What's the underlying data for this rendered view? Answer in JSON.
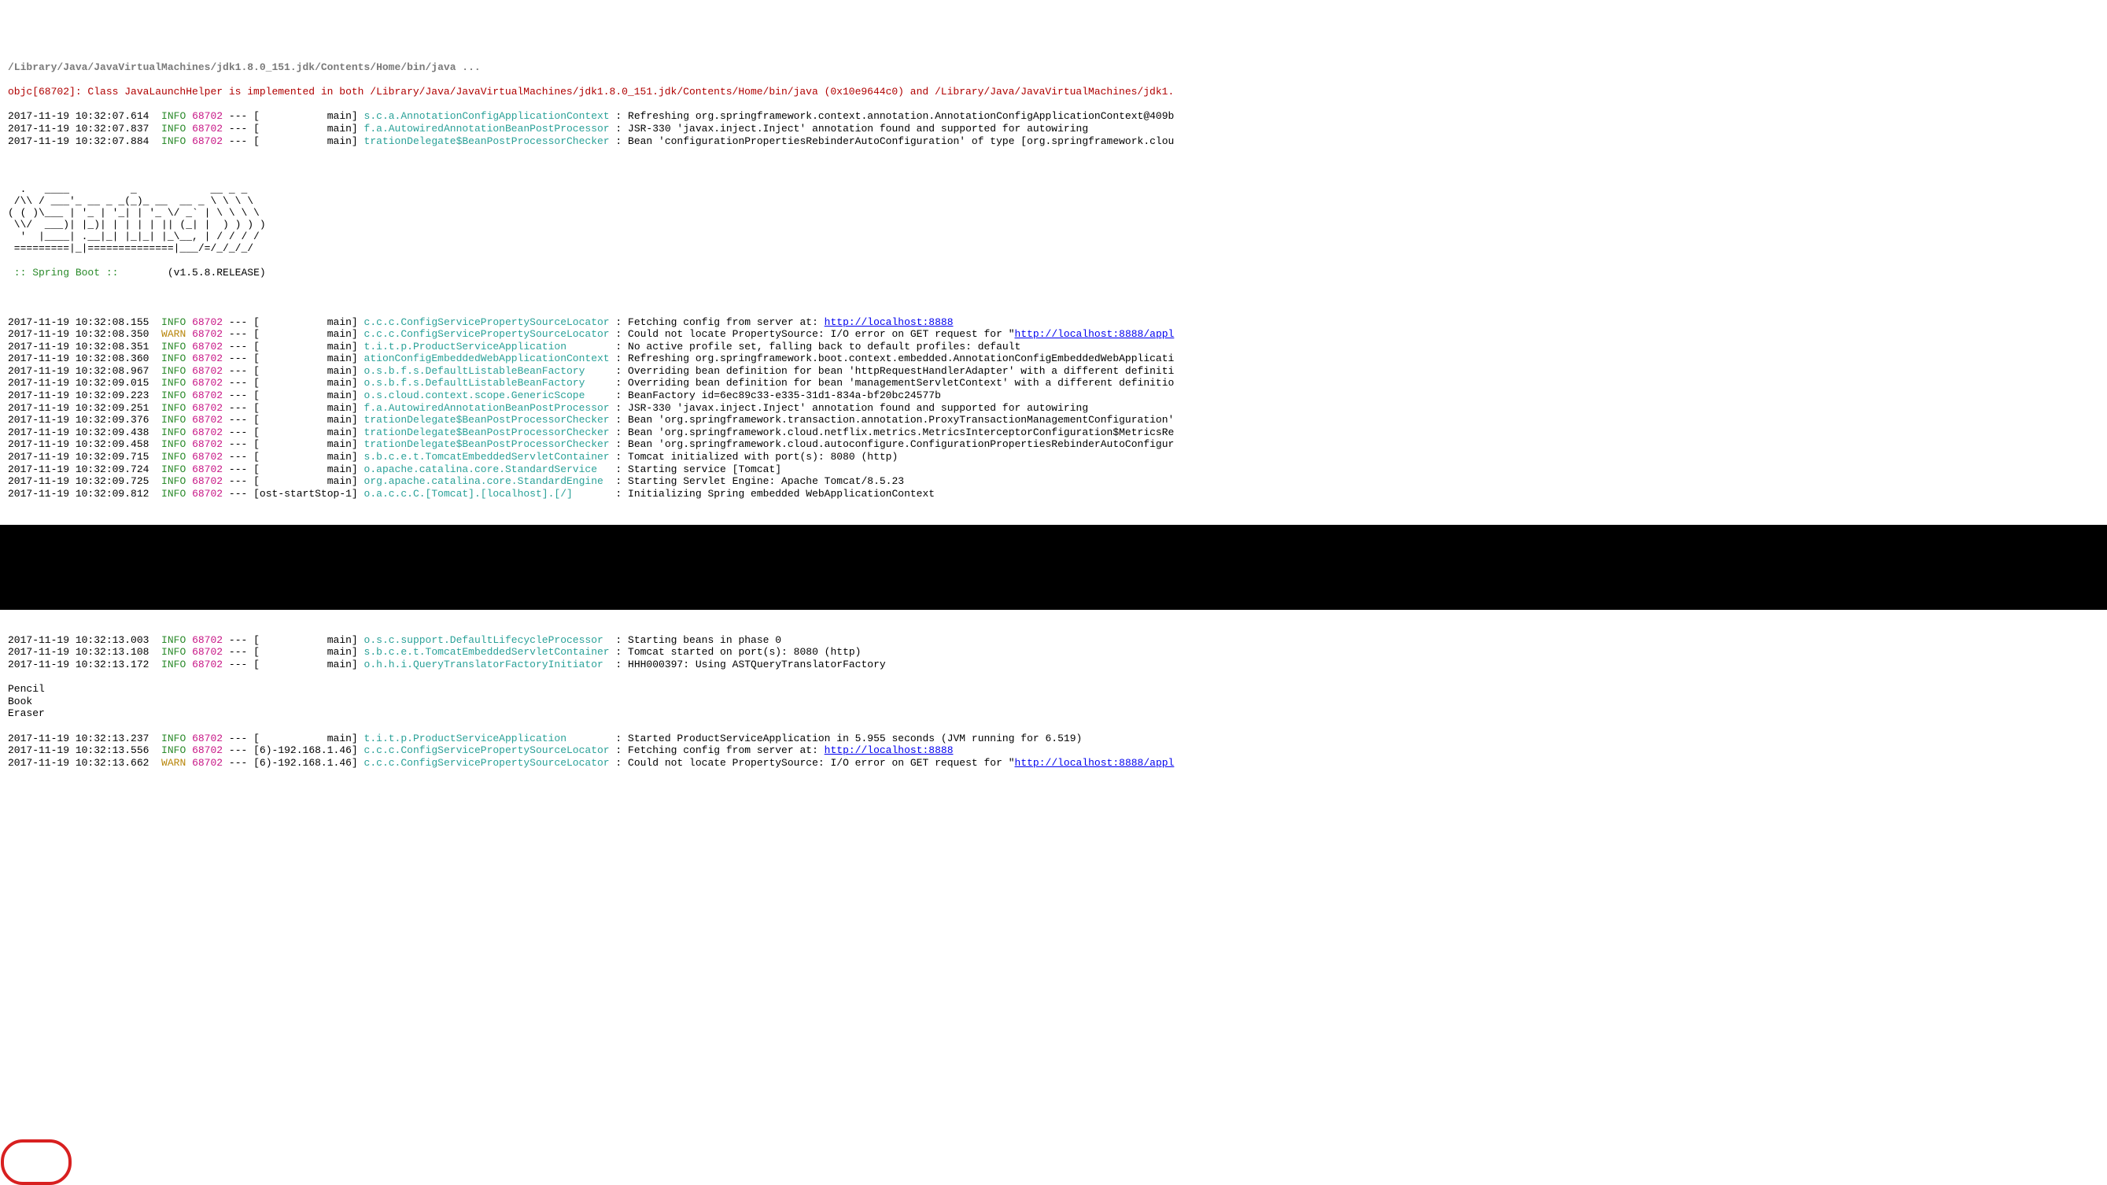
{
  "header": "/Library/Java/JavaVirtualMachines/jdk1.8.0_151.jdk/Contents/Home/bin/java ...",
  "objc": "objc[68702]: Class JavaLaunchHelper is implemented in both /Library/Java/JavaVirtualMachines/jdk1.8.0_151.jdk/Contents/Home/bin/java (0x10e9644c0) and /Library/Java/JavaVirtualMachines/jdk1.",
  "pre_logs": [
    {
      "ts": "2017-11-19 10:32:07.614",
      "lvl": "INFO",
      "pid": "68702",
      "thread": "[           main]",
      "logger": "s.c.a.AnnotationConfigApplicationContext",
      "msg": ": Refreshing org.springframework.context.annotation.AnnotationConfigApplicationContext@409b"
    },
    {
      "ts": "2017-11-19 10:32:07.837",
      "lvl": "INFO",
      "pid": "68702",
      "thread": "[           main]",
      "logger": "f.a.AutowiredAnnotationBeanPostProcessor",
      "msg": ": JSR-330 'javax.inject.Inject' annotation found and supported for autowiring"
    },
    {
      "ts": "2017-11-19 10:32:07.884",
      "lvl": "INFO",
      "pid": "68702",
      "thread": "[           main]",
      "logger": "trationDelegate$BeanPostProcessorChecker",
      "msg": ": Bean 'configurationPropertiesRebinderAutoConfiguration' of type [org.springframework.clou"
    }
  ],
  "ascii": [
    "  .   ____          _            __ _ _",
    " /\\\\ / ___'_ __ _ _(_)_ __  __ _ \\ \\ \\ \\",
    "( ( )\\___ | '_ | '_| | '_ \\/ _` | \\ \\ \\ \\",
    " \\\\/  ___)| |_)| | | | | || (_| |  ) ) ) )",
    "  '  |____| .__|_| |_|_| |_\\__, | / / / /",
    " =========|_|==============|___/=/_/_/_/"
  ],
  "spring_label": " :: Spring Boot ::",
  "spring_version": "        (v1.5.8.RELEASE)",
  "mid_logs": [
    {
      "ts": "2017-11-19 10:32:08.155",
      "lvl": "INFO",
      "pid": "68702",
      "thread": "[           main]",
      "logger": "c.c.c.ConfigServicePropertySourceLocator",
      "msg_pre": ": Fetching config from server at: ",
      "link": "http://localhost:8888",
      "msg_post": ""
    },
    {
      "ts": "2017-11-19 10:32:08.350",
      "lvl": "WARN",
      "pid": "68702",
      "thread": "[           main]",
      "logger": "c.c.c.ConfigServicePropertySourceLocator",
      "msg_pre": ": Could not locate PropertySource: I/O error on GET request for \"",
      "link": "http://localhost:8888/appl",
      "msg_post": ""
    },
    {
      "ts": "2017-11-19 10:32:08.351",
      "lvl": "INFO",
      "pid": "68702",
      "thread": "[           main]",
      "logger": "t.i.t.p.ProductServiceApplication       ",
      "msg": ": No active profile set, falling back to default profiles: default"
    },
    {
      "ts": "2017-11-19 10:32:08.360",
      "lvl": "INFO",
      "pid": "68702",
      "thread": "[           main]",
      "logger": "ationConfigEmbeddedWebApplicationContext",
      "msg": ": Refreshing org.springframework.boot.context.embedded.AnnotationConfigEmbeddedWebApplicati"
    },
    {
      "ts": "2017-11-19 10:32:08.967",
      "lvl": "INFO",
      "pid": "68702",
      "thread": "[           main]",
      "logger": "o.s.b.f.s.DefaultListableBeanFactory    ",
      "msg": ": Overriding bean definition for bean 'httpRequestHandlerAdapter' with a different definiti"
    },
    {
      "ts": "2017-11-19 10:32:09.015",
      "lvl": "INFO",
      "pid": "68702",
      "thread": "[           main]",
      "logger": "o.s.b.f.s.DefaultListableBeanFactory    ",
      "msg": ": Overriding bean definition for bean 'managementServletContext' with a different definitio"
    },
    {
      "ts": "2017-11-19 10:32:09.223",
      "lvl": "INFO",
      "pid": "68702",
      "thread": "[           main]",
      "logger": "o.s.cloud.context.scope.GenericScope    ",
      "msg": ": BeanFactory id=6ec89c33-e335-31d1-834a-bf20bc24577b"
    },
    {
      "ts": "2017-11-19 10:32:09.251",
      "lvl": "INFO",
      "pid": "68702",
      "thread": "[           main]",
      "logger": "f.a.AutowiredAnnotationBeanPostProcessor",
      "msg": ": JSR-330 'javax.inject.Inject' annotation found and supported for autowiring"
    },
    {
      "ts": "2017-11-19 10:32:09.376",
      "lvl": "INFO",
      "pid": "68702",
      "thread": "[           main]",
      "logger": "trationDelegate$BeanPostProcessorChecker",
      "msg": ": Bean 'org.springframework.transaction.annotation.ProxyTransactionManagementConfiguration'"
    },
    {
      "ts": "2017-11-19 10:32:09.438",
      "lvl": "INFO",
      "pid": "68702",
      "thread": "[           main]",
      "logger": "trationDelegate$BeanPostProcessorChecker",
      "msg": ": Bean 'org.springframework.cloud.netflix.metrics.MetricsInterceptorConfiguration$MetricsRe"
    },
    {
      "ts": "2017-11-19 10:32:09.458",
      "lvl": "INFO",
      "pid": "68702",
      "thread": "[           main]",
      "logger": "trationDelegate$BeanPostProcessorChecker",
      "msg": ": Bean 'org.springframework.cloud.autoconfigure.ConfigurationPropertiesRebinderAutoConfigur"
    },
    {
      "ts": "2017-11-19 10:32:09.715",
      "lvl": "INFO",
      "pid": "68702",
      "thread": "[           main]",
      "logger": "s.b.c.e.t.TomcatEmbeddedServletContainer",
      "msg": ": Tomcat initialized with port(s): 8080 (http)"
    },
    {
      "ts": "2017-11-19 10:32:09.724",
      "lvl": "INFO",
      "pid": "68702",
      "thread": "[           main]",
      "logger": "o.apache.catalina.core.StandardService  ",
      "msg": ": Starting service [Tomcat]"
    },
    {
      "ts": "2017-11-19 10:32:09.725",
      "lvl": "INFO",
      "pid": "68702",
      "thread": "[           main]",
      "logger": "org.apache.catalina.core.StandardEngine ",
      "msg": ": Starting Servlet Engine: Apache Tomcat/8.5.23"
    },
    {
      "ts": "2017-11-19 10:32:09.812",
      "lvl": "INFO",
      "pid": "68702",
      "thread": "[ost-startStop-1]",
      "logger": "o.a.c.c.C.[Tomcat].[localhost].[/]      ",
      "msg": ": Initializing Spring embedded WebApplicationContext"
    }
  ],
  "post_logs_1": [
    {
      "ts": "2017-11-19 10:32:13.003",
      "lvl": "INFO",
      "pid": "68702",
      "thread": "[           main]",
      "logger": "o.s.c.support.DefaultLifecycleProcessor ",
      "msg": ": Starting beans in phase 0"
    },
    {
      "ts": "2017-11-19 10:32:13.108",
      "lvl": "INFO",
      "pid": "68702",
      "thread": "[           main]",
      "logger": "s.b.c.e.t.TomcatEmbeddedServletContainer",
      "msg": ": Tomcat started on port(s): 8080 (http)"
    },
    {
      "ts": "2017-11-19 10:32:13.172",
      "lvl": "INFO",
      "pid": "68702",
      "thread": "[           main]",
      "logger": "o.h.h.i.QueryTranslatorFactoryInitiator ",
      "msg": ": HHH000397: Using ASTQueryTranslatorFactory"
    }
  ],
  "stdout_items": [
    "Pencil",
    "Book",
    "Eraser"
  ],
  "post_logs_2": [
    {
      "ts": "2017-11-19 10:32:13.237",
      "lvl": "INFO",
      "pid": "68702",
      "thread": "[           main]",
      "logger": "t.i.t.p.ProductServiceApplication       ",
      "msg": ": Started ProductServiceApplication in 5.955 seconds (JVM running for 6.519)"
    },
    {
      "ts": "2017-11-19 10:32:13.556",
      "lvl": "INFO",
      "pid": "68702",
      "thread": "[6)-192.168.1.46]",
      "logger": "c.c.c.ConfigServicePropertySourceLocator",
      "msg_pre": ": Fetching config from server at: ",
      "link": "http://localhost:8888",
      "msg_post": ""
    },
    {
      "ts": "2017-11-19 10:32:13.662",
      "lvl": "WARN",
      "pid": "68702",
      "thread": "[6)-192.168.1.46]",
      "logger": "c.c.c.ConfigServicePropertySourceLocator",
      "msg_pre": ": Could not locate PropertySource: I/O error on GET request for \"",
      "link": "http://localhost:8888/appl",
      "msg_post": ""
    }
  ]
}
